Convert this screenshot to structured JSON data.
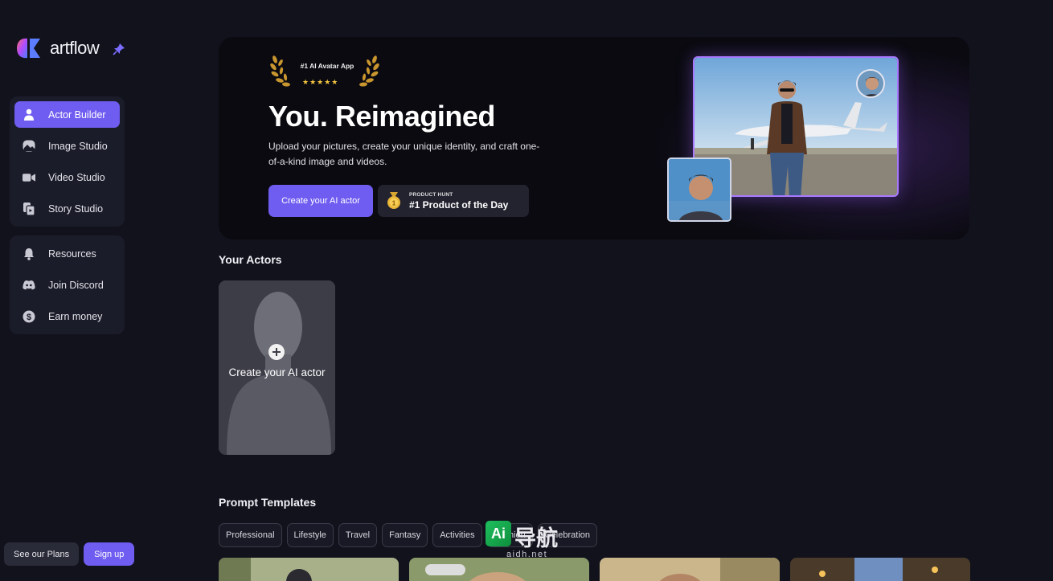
{
  "app": {
    "name": "artflow"
  },
  "sidebar": {
    "primary": [
      {
        "label": "Actor Builder",
        "icon": "person-icon",
        "active": true
      },
      {
        "label": "Image Studio",
        "icon": "image-icon",
        "active": false
      },
      {
        "label": "Video Studio",
        "icon": "video-icon",
        "active": false
      },
      {
        "label": "Story Studio",
        "icon": "story-icon",
        "active": false
      }
    ],
    "secondary": [
      {
        "label": "Resources",
        "icon": "bell-icon"
      },
      {
        "label": "Join Discord",
        "icon": "discord-icon"
      },
      {
        "label": "Earn money",
        "icon": "dollar-icon"
      }
    ],
    "see_plans": "See our Plans",
    "sign_up": "Sign up"
  },
  "hero": {
    "award": "#1 AI Avatar App",
    "stars": "★★★★★",
    "title": "You. Reimagined",
    "description": "Upload your pictures, create your unique identity, and craft one-of-a-kind image and videos.",
    "cta": "Create your AI actor",
    "badge_small": "PRODUCT HUNT",
    "badge_big": "#1 Product of the Day"
  },
  "actors": {
    "title": "Your Actors",
    "create_label": "Create your AI actor"
  },
  "templates": {
    "title": "Prompt Templates",
    "chips": [
      "Professional",
      "Lifestyle",
      "Travel",
      "Fantasy",
      "Activities",
      "Fashion",
      "Celebration"
    ]
  },
  "watermark": {
    "mark": "Ai",
    "cn": "导航",
    "url": "aidh.net"
  },
  "colors": {
    "accent": "#6f5cf0",
    "background": "#11121c",
    "panel": "#1b1c29"
  }
}
